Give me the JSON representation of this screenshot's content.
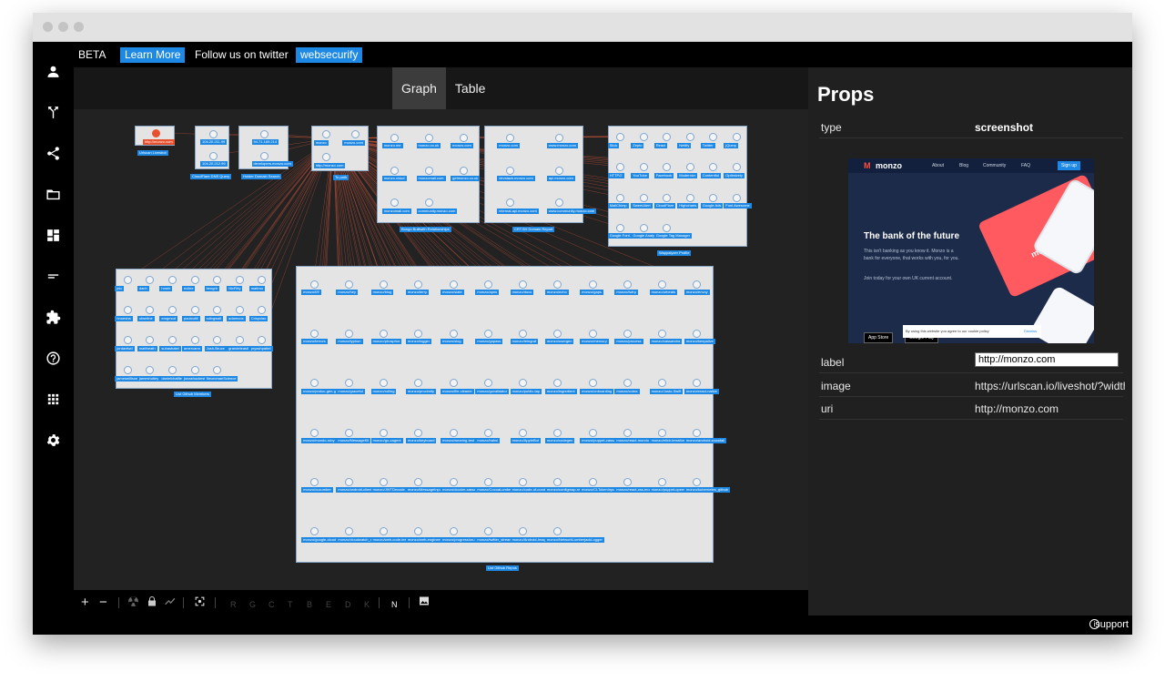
{
  "topbar": {
    "beta": "BETA",
    "learn_more": "Learn More",
    "follow": "Follow us on twitter",
    "handle": "websecurify"
  },
  "sidebar": {
    "icons": [
      "user-icon",
      "merge-icon",
      "share-icon",
      "folder-icon",
      "dashboard-icon",
      "short-text-icon",
      "extension-icon",
      "help-icon",
      "apps-icon",
      "settings-icon"
    ]
  },
  "view_tabs": [
    "Graph",
    "Table"
  ],
  "graph": {
    "groups": [
      {
        "label": "Urlscan Liveshot",
        "nodes": [
          "http://monzo.com"
        ]
      },
      {
        "label": "CloudFlare DNS Query",
        "nodes": [
          "104.20.211.99",
          "104.20.212.99"
        ]
      },
      {
        "label": "Holder Domain Search",
        "nodes": [
          "94.71.169.214",
          "developers.monzo.com"
        ]
      },
      {
        "label": "To path",
        "nodes": [
          "monzo",
          "monzo.com",
          "http://monzo.com"
        ]
      },
      {
        "label": "Bongo Builtwith Relationships",
        "nodes": [
          "monzo.me",
          "monzo.co.uk",
          "monzo.com",
          "monzo.cloud",
          "monzomail.com",
          "getmonzo.co.uk",
          "monzomail.com",
          "community.monzo.com"
        ]
      },
      {
        "label": "CRT.SH Domain Report",
        "nodes": [
          "monzo.com",
          "www.monzo.com",
          "devstack.monzo.com",
          "api.monzo.com",
          "internal-api.monzo.com",
          "www.community.monzo.com"
        ]
      },
      {
        "label": "Wappalyzer Profile",
        "nodes": [
          "Slick",
          "Zepto",
          "React",
          "Netlify",
          "Twitter",
          "jQuery",
          "HTTP/2",
          "YouTube",
          "Facebook",
          "Modernizr",
          "Contentful",
          "Optimizely",
          "MailChimp",
          "SweetAlert",
          "CloudFlare",
          "Highcharts",
          "Google Ads",
          "Font Awesome",
          "Google Font API",
          "Google Analytics",
          "Google Tag Manager"
        ]
      },
      {
        "label": "List Github Members",
        "nodes": [
          "jnic",
          "danh",
          "hmeir",
          "ricline",
          "bengrh",
          "NicFitty",
          "mattmo",
          "hnoesha",
          "obseline",
          "emgmod",
          "paulcutili",
          "sdingwall",
          "adamoos",
          "Crispxiao",
          "jordanfwd",
          "mattheath",
          "suhasbatel",
          "amercarro",
          "Josh-Bruce",
          "grandeleasti",
          "pryashpattel",
          "jameseillison",
          "jameshutley",
          "danielchatfield",
          "jonashuckestein",
          "NeuromanScience"
        ]
      },
      {
        "label": "List Github Repos",
        "nodes": [
          "monzo/f/f/",
          "monzo/hey",
          "monzo/blog",
          "monzo/terry",
          "monzo/slate",
          "monzo/apns",
          "monzo/docs",
          "monzo/echo",
          "monzo/gaps",
          "monzo/twirp",
          "monzo/orbeats",
          "monzo/envoy",
          "monzo/terrors",
          "monzo/typhon",
          "monzo/phosphor",
          "monzo/logger",
          "monzo/slog",
          "monzo/gopass",
          "monzo/telegraf",
          "monzo/usergen",
          "monzo/mercury",
          "monzo/process",
          "monzo/cassandra",
          "monzo/keepalive",
          "monzo/protoc-gen-go",
          "monzo/graceful",
          "monzo/rolling",
          "monzo/proximity",
          "monzo/file-cleaner",
          "monzo/govalidator",
          "monzo/public-tap",
          "monzo/ingredient",
          "monzo/onboarding",
          "monzo/cobra",
          "monzo/Justo-Swift",
          "monzo/react-native",
          "monzo/mondo-ruby",
          "monzo/MessageKit",
          "monzo/go-cagent",
          "monzo/keyboard",
          "monzo/wearing-test",
          "monzo/bahsi",
          "monzo/AppleBot",
          "monzo/codegen",
          "monzo/puppet-cassandra",
          "monzo/react-mondo",
          "monzo/elixir-terraform",
          "monzo/android-snowfall",
          "monzo/cucumber",
          "monzo/android-client",
          "monzo/JWTDecode.swift",
          "monzo/MessageInputBar",
          "monzo/docker-cassandra",
          "monzo/CocoaLumberjack",
          "monzo/code-of-conduct",
          "monzo/configmap-reload",
          "monzo/CLTokenInputView",
          "monzo/react-css-modules",
          "monzo/puppet-openvpn",
          "monzo/kubernetes_github",
          "monzo/google-cloud-python",
          "monzo/cloudwatch_exporter",
          "monzo/web-code-test-server",
          "monzo/web-engineer-exercise",
          "monzo/progression-framework",
          "monzo/twitter_stream_exporter",
          "monzo/Android-Image-Cropper",
          "monzo/NetworkLumberjackLogger"
        ]
      }
    ]
  },
  "toolbar": {
    "zoom_in": "+",
    "zoom_out": "−",
    "letters": [
      "R",
      "G",
      "C",
      "T",
      "B",
      "E",
      "D",
      "K"
    ],
    "n": "N"
  },
  "props": {
    "title": "Props",
    "rows": {
      "type": {
        "key": "type",
        "value": "screenshot"
      },
      "label": {
        "key": "label",
        "value": "http://monzo.com"
      },
      "image": {
        "key": "image",
        "value": "https://urlscan.io/liveshot/?width"
      },
      "uri": {
        "key": "uri",
        "value": "http://monzo.com"
      }
    },
    "screenshot": {
      "brand": "monzo",
      "nav": [
        "About",
        "Blog",
        "Community",
        "FAQ"
      ],
      "signup": "Sign up",
      "headline": "The bank of the future",
      "body": "This isn't banking as you know it. Monzo is a bank for everyone, that works with you, for you.",
      "join": "Join today for your own UK current account.",
      "app_store": "App Store",
      "google_play": "Google Play",
      "cookie": "By using this website you agree to our cookie policy",
      "dismiss": "Dismiss",
      "card_text": "monzo"
    }
  },
  "footer": {
    "support": "support"
  },
  "colors": {
    "accent": "#1e88e5",
    "edge": "#d9583c",
    "node_ring": "#7ea6d1"
  }
}
